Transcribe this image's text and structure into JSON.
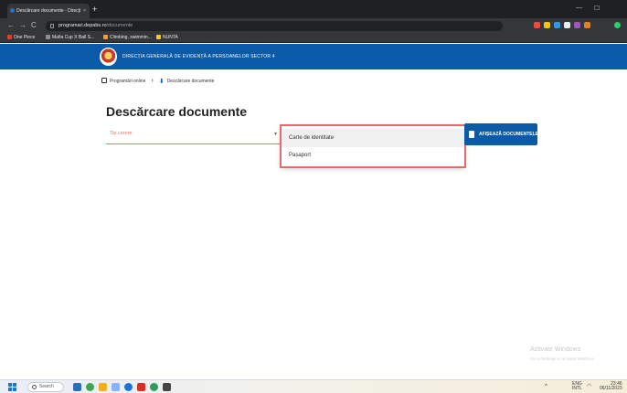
{
  "browser": {
    "tab_title": "Descărcare documente - Direcți",
    "tab_close": "×",
    "new_tab": "+",
    "window_controls": {
      "minimize": "—",
      "maximize": "☐"
    },
    "nav": {
      "back": "←",
      "forward": "→",
      "reload": "C"
    },
    "url_host": "programari.depabs.ro",
    "url_path": "/documente",
    "bookmarks": [
      "One Piece",
      "Mafia Cup X Ball S...",
      "Climbing, swimmin...",
      "NUNTA"
    ],
    "extension_colors": [
      "#e74c3c",
      "#f1c40f",
      "#3498db",
      "#ecf0f1",
      "#9b59b6",
      "#e67e22",
      "#2ecc71"
    ]
  },
  "site": {
    "header_title": "DIRECȚIA GENERALĂ DE EVIDENȚĂ A PERSOANELOR SECTOR 4",
    "brand_color": "#0b5aa8"
  },
  "breadcrumb": {
    "home_label": "Programări online",
    "separator": "›",
    "current_label": "Descărcare documente"
  },
  "main": {
    "page_title": "Descărcare documente",
    "select_placeholder": "Tip cerere",
    "select_arrow": "▼",
    "options": [
      "Carte de identitate",
      "Pașaport"
    ],
    "button_label": "AFIȘEAZĂ DOCUMENTELE"
  },
  "watermark": {
    "title": "Activate Windows",
    "subtitle": "Go to Settings to activate Windows."
  },
  "taskbar": {
    "search_label": "Search",
    "tray_lang": "ENG",
    "tray_region": "INTL",
    "time": "23:46",
    "date": "06/11/2023",
    "icon_colors": [
      "#2c6fb7",
      "#3aa757",
      "#f2b01e",
      "#e0e0e0",
      "#1e73d8",
      "#d93025",
      "#2e9c5a",
      "#444444"
    ]
  }
}
